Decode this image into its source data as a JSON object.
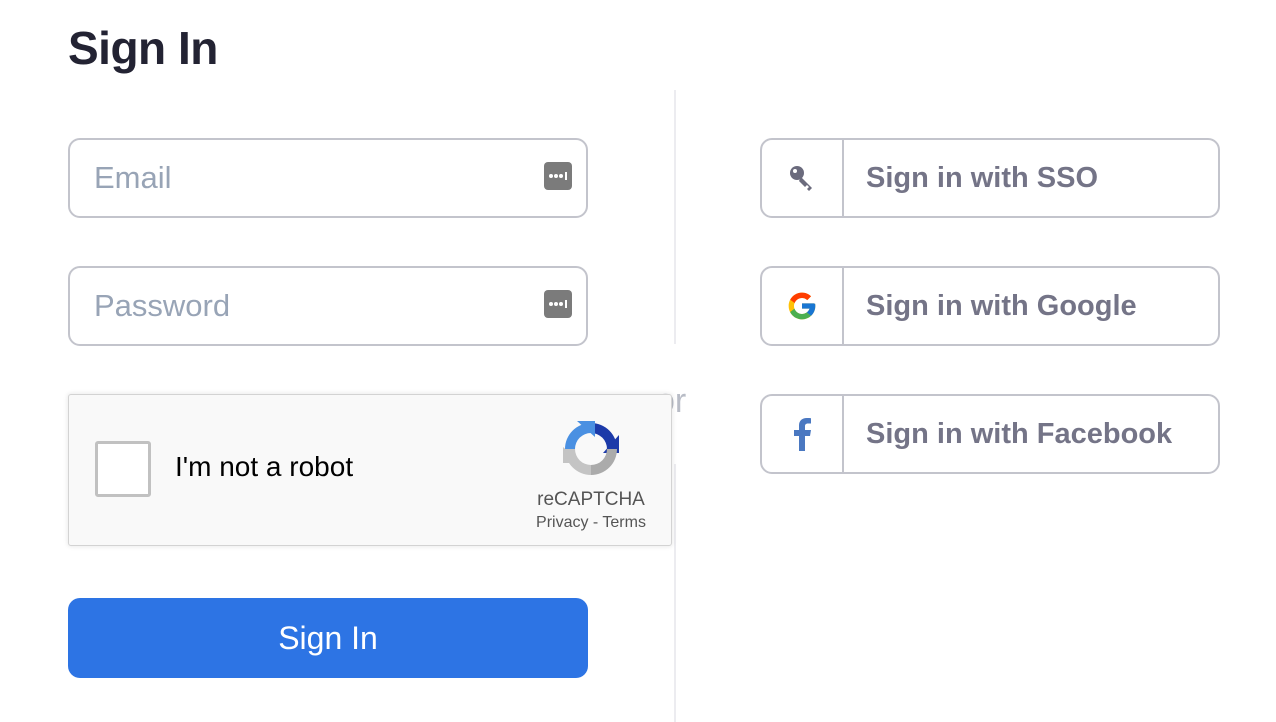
{
  "header": {
    "title": "Sign In"
  },
  "form": {
    "email": {
      "placeholder": "Email",
      "value": ""
    },
    "password": {
      "placeholder": "Password",
      "value": ""
    },
    "separator": "or",
    "submit_label": "Sign In"
  },
  "captcha": {
    "label": "I'm not a robot",
    "brand": "reCAPTCHA",
    "privacy": "Privacy",
    "links_separator": "-",
    "terms": "Terms",
    "checked": false
  },
  "sso": {
    "buttons": [
      {
        "label": "Sign in with SSO",
        "icon": "key-icon"
      },
      {
        "label": "Sign in with Google",
        "icon": "google-icon"
      },
      {
        "label": "Sign in with Facebook",
        "icon": "facebook-icon"
      }
    ]
  },
  "colors": {
    "primary": "#2d74e4",
    "title": "#232333",
    "border": "#c3c4cc",
    "secondary_text": "#747487",
    "facebook": "#4a78c1"
  }
}
